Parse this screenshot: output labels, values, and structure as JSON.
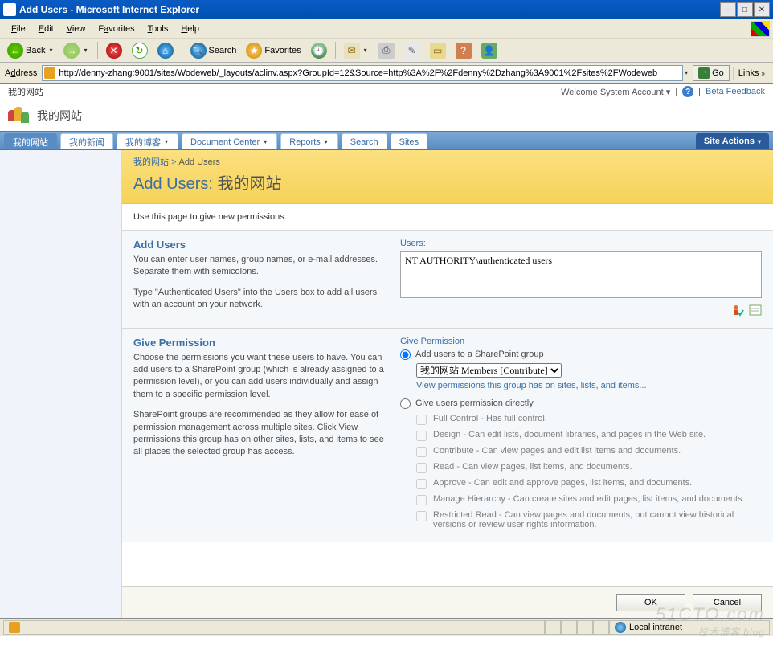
{
  "window": {
    "title": "Add Users - Microsoft Internet Explorer"
  },
  "menus": {
    "file": "File",
    "edit": "Edit",
    "view": "View",
    "favorites": "Favorites",
    "tools": "Tools",
    "help": "Help"
  },
  "toolbar": {
    "back": "Back",
    "search": "Search",
    "favorites": "Favorites"
  },
  "address": {
    "label": "Address",
    "url": "http://denny-zhang:9001/sites/Wodeweb/_layouts/aclinv.aspx?GroupId=12&Source=http%3A%2F%2Fdenny%2Dzhang%3A9001%2Fsites%2FWodeweb",
    "go": "Go",
    "links": "Links"
  },
  "top": {
    "siteleft": "我的网站",
    "welcome": "Welcome System Account",
    "beta": "Beta Feedback",
    "sitelogo_title": "我的网站"
  },
  "nav": {
    "tabs": [
      {
        "label": "我的网站",
        "active": true,
        "drop": false
      },
      {
        "label": "我的新闻",
        "active": false,
        "drop": false
      },
      {
        "label": "我的博客",
        "active": false,
        "drop": true
      },
      {
        "label": "Document Center",
        "active": false,
        "drop": true
      },
      {
        "label": "Reports",
        "active": false,
        "drop": true
      },
      {
        "label": "Search",
        "active": false,
        "drop": false
      },
      {
        "label": "Sites",
        "active": false,
        "drop": false
      }
    ],
    "site_actions": "Site Actions"
  },
  "breadcrumb": {
    "root": "我的网站",
    "current": "Add Users"
  },
  "page": {
    "title_prefix": "Add Users: ",
    "title_site": "我的网站",
    "desc": "Use this page to give new permissions."
  },
  "section1": {
    "head": "Add Users",
    "p1": "You can enter user names, group names, or e-mail addresses. Separate them with semicolons.",
    "p2": "Type \"Authenticated Users\" into the Users box to add all users with an account on your network.",
    "users_label": "Users:",
    "users_value": "NT AUTHORITY\\authenticated users"
  },
  "section2": {
    "head": "Give Permission",
    "p1": "Choose the permissions you want these users to have. You can add users to a SharePoint group (which is already assigned to a permission level), or you can add users individually and assign them to a specific permission level.",
    "p2": "SharePoint groups are recommended as they allow for ease of permission management across multiple sites. Click View permissions this group has on other sites, lists, and items to see all places the selected group has access.",
    "right_head": "Give Permission",
    "opt1": "Add users to a SharePoint group",
    "group_select": "我的网站 Members [Contribute]",
    "view_link": "View permissions this group has on sites, lists, and items...",
    "opt2": "Give users permission directly",
    "perms": [
      "Full Control - Has full control.",
      "Design - Can edit lists, document libraries, and pages in the Web site.",
      "Contribute - Can view pages and edit list items and documents.",
      "Read - Can view pages, list items, and documents.",
      "Approve - Can edit and approve pages, list items, and documents.",
      "Manage Hierarchy - Can create sites and edit pages, list items, and documents.",
      "Restricted Read - Can view pages and documents, but cannot view historical versions or review user rights information."
    ]
  },
  "buttons": {
    "ok": "OK",
    "cancel": "Cancel"
  },
  "status": {
    "zone": "Local intranet"
  },
  "watermark": {
    "big": "51CTO.com",
    "sm": "技术博客  blog"
  }
}
